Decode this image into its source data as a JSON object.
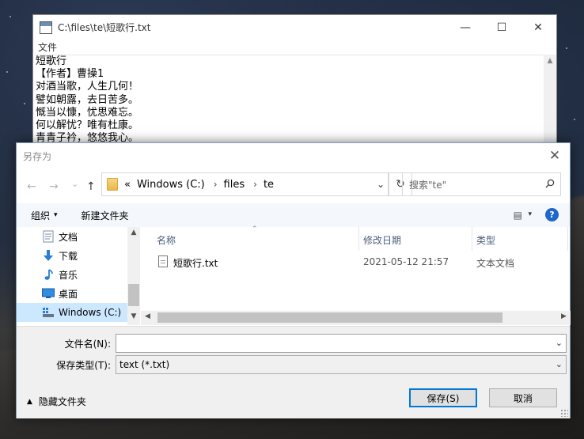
{
  "main_window": {
    "title": "C:\\files\\te\\短歌行.txt",
    "menu": [
      "文件"
    ],
    "controls": {
      "minimize": "—",
      "maximize": "☐",
      "close": "✕"
    },
    "lines": [
      "短歌行",
      "【作者】曹操1",
      "对酒当歌，人生几何！",
      "譬如朝露，去日苦多。",
      "慨当以慷，忧思难忘。",
      "何以解忧？唯有杜康。",
      "青青子衿，悠悠我心。"
    ]
  },
  "dialog": {
    "title": "另存为",
    "close": "✕",
    "nav": {
      "back": "←",
      "forward": "→",
      "recent": "⌄",
      "up": "↑"
    },
    "address": {
      "prefix": "«",
      "crumbs": [
        "Windows (C:)",
        "files",
        "te"
      ],
      "separator": "›",
      "dropdown": "⌄"
    },
    "refresh": "↻",
    "search": {
      "placeholder": "搜索\"te\""
    },
    "toolbar": {
      "organize": "组织",
      "new_folder": "新建文件夹",
      "caret": "▾",
      "view": "▤",
      "help": "?"
    },
    "tree": [
      {
        "label": "文档",
        "icon": "documents-icon"
      },
      {
        "label": "下载",
        "icon": "download-icon"
      },
      {
        "label": "音乐",
        "icon": "music-icon"
      },
      {
        "label": "桌面",
        "icon": "desktop-icon"
      },
      {
        "label": "Windows (C:)",
        "icon": "drive-icon",
        "selected": true
      }
    ],
    "columns": {
      "name": "名称",
      "modified": "修改日期",
      "type": "类型"
    },
    "files": [
      {
        "name": "短歌行.txt",
        "modified": "2021-05-12 21:57",
        "type": "文本文档"
      }
    ],
    "filename": {
      "label": "文件名(N):",
      "value": ""
    },
    "filetype": {
      "label": "保存类型(T):",
      "value": "text (*.txt)"
    },
    "hide_folders": "隐藏文件夹",
    "save": "保存(S)",
    "cancel": "取消"
  },
  "colors": {
    "accent": "#0078d7",
    "selection": "#cce8ff",
    "help": "#1f67c8"
  }
}
